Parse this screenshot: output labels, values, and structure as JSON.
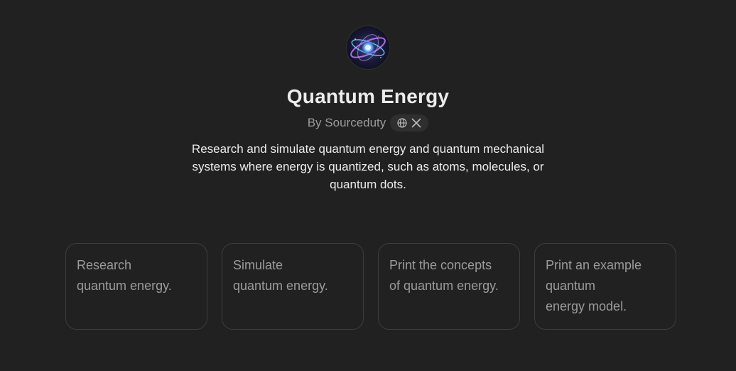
{
  "gpt": {
    "title": "Quantum Energy",
    "author": "By Sourceduty",
    "avatar_icon": "quantum-orbital-avatar",
    "social_icons": [
      "globe-icon",
      "x-logo-icon"
    ],
    "description": "Research and simulate quantum energy and quantum mechanical systems where energy is quantized, such as atoms, molecules, or quantum dots."
  },
  "starters": [
    {
      "lines": [
        "Research",
        "quantum energy."
      ]
    },
    {
      "lines": [
        "Simulate",
        "quantum energy."
      ]
    },
    {
      "lines": [
        "Print the concepts",
        "of quantum energy."
      ]
    },
    {
      "lines": [
        "Print an example",
        "quantum",
        "energy model."
      ]
    }
  ],
  "colors": {
    "background": "#212121",
    "text": "#ececec",
    "muted": "#9b9b9b",
    "card_border": "#3d3d3d"
  }
}
